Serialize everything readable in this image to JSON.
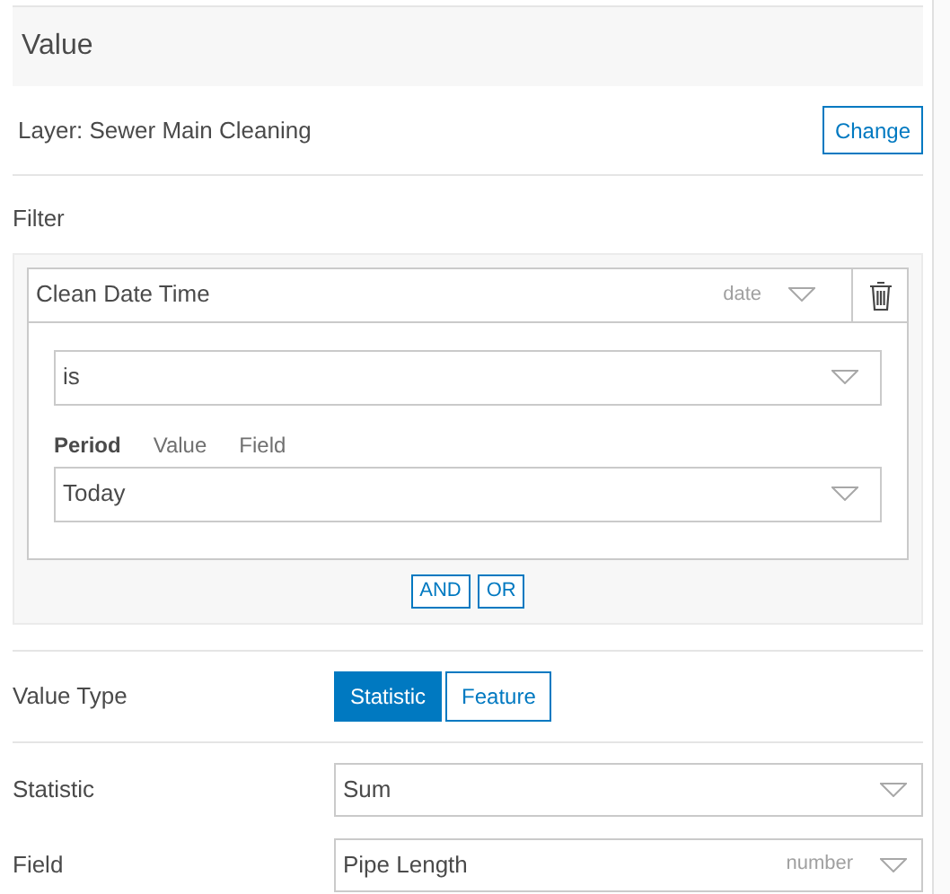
{
  "header": {
    "title": "Value"
  },
  "layer": {
    "label": "Layer: Sewer Main Cleaning",
    "button": "Change"
  },
  "filter": {
    "label": "Filter",
    "field": {
      "value": "Clean Date Time",
      "type": "date"
    },
    "operator": {
      "value": "is"
    },
    "tabs": [
      {
        "label": "Period",
        "selected": true
      },
      {
        "label": "Value",
        "selected": false
      },
      {
        "label": "Field",
        "selected": false
      }
    ],
    "period": {
      "value": "Today"
    },
    "logic_buttons": [
      "AND",
      "OR"
    ]
  },
  "value_type": {
    "label": "Value Type",
    "options": [
      {
        "label": "Statistic",
        "selected": true
      },
      {
        "label": "Feature",
        "selected": false
      }
    ]
  },
  "statistic": {
    "label": "Statistic",
    "value": "Sum"
  },
  "field": {
    "label": "Field",
    "value": "Pipe Length",
    "type": "number"
  }
}
